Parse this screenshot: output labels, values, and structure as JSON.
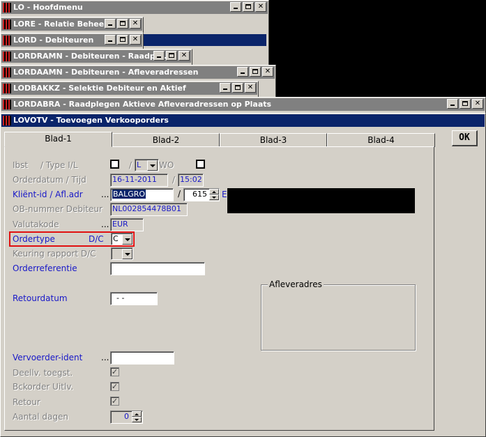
{
  "windows": [
    {
      "title": "LO - Hoofdmenu"
    },
    {
      "title": "LORE - Relatie Beheer"
    },
    {
      "title": "LORD - Debiteuren"
    },
    {
      "title": "LORDRAMN - Debiteuren - Raadpl..."
    },
    {
      "title": "LORDAAMN - Debiteuren - Afleveradressen"
    },
    {
      "title": "LODBAKKZ - Selektie Debiteur en Aktief"
    },
    {
      "title": "LORDABRA - Raadplegen Aktieve Afleveradressen op Plaats"
    },
    {
      "title": "LOVOTV - Toevoegen Verkooporders"
    }
  ],
  "tabs": [
    "Blad-1",
    "Blad-2",
    "Blad-3",
    "Blad-4"
  ],
  "ok_label": "OK",
  "form": {
    "ibst_label": "Ibst",
    "type_label": "/ Type I/L",
    "type_sep": "/",
    "type_value": "L",
    "wo_label": "WO",
    "orderdatum_label": "Orderdatum / Tijd",
    "orderdatum_value": "16-11-2011",
    "tijd_sep": "/",
    "tijd_value": "15:02",
    "klient_label": "Kliënt-id / Afl.adr",
    "klient_dots": "...",
    "klient_value": "BALGRO",
    "afl_sep": "/",
    "afl_value": "615",
    "afl_suffix": "E",
    "ob_label": "OB-nummer Debiteur",
    "ob_value": "NL002854478B01",
    "valuta_label": "Valutakode",
    "valuta_dots": "...",
    "valuta_value": "EUR",
    "ordertype_label": "Ordertype",
    "ordertype_dc": "D/C",
    "ordertype_value": "C",
    "keuring_label": "Keuring rapport D/C",
    "orderref_label": "Orderreferentie",
    "orderref_value": "",
    "retour_label": "Retourdatum",
    "retour_value": "- -",
    "afleveradres_label": "Afleveradres",
    "vervoerder_label": "Vervoerder-ident",
    "vervoerder_dots": "...",
    "vervoerder_value": "",
    "deellv_label": "Deellv. toegst.",
    "bckorder_label": "Bckorder Uitlv.",
    "retourchk_label": "Retour",
    "aantal_label": "Aantal dagen",
    "aantal_value": "0",
    "check_mark": "✓"
  }
}
